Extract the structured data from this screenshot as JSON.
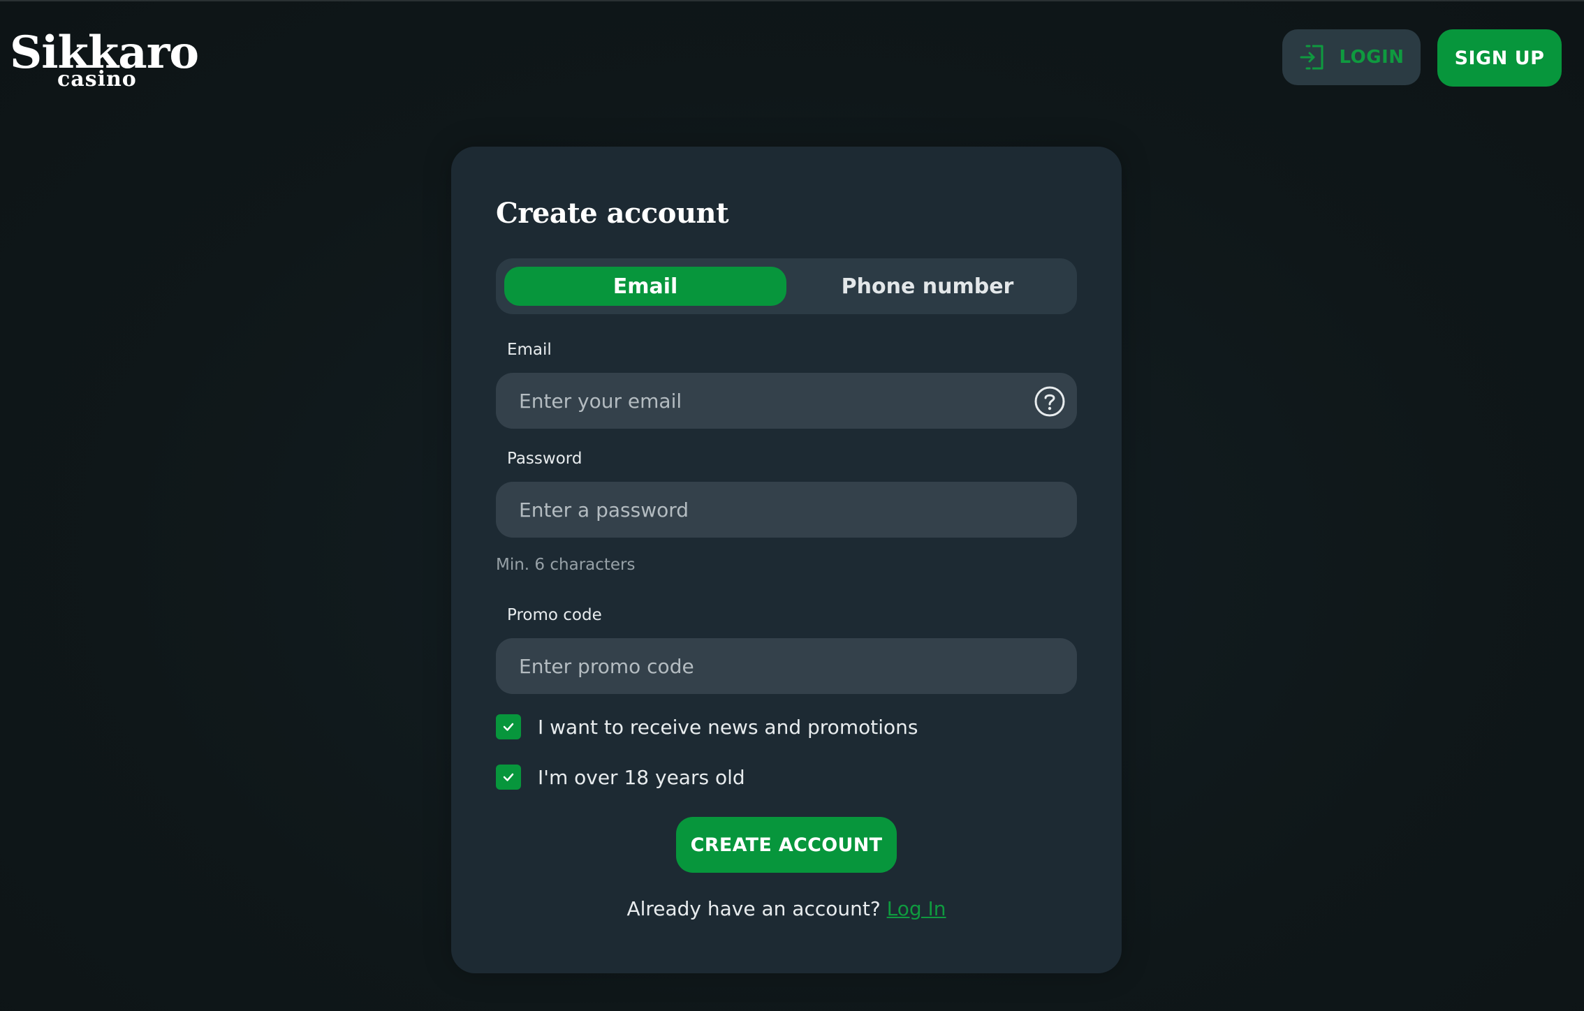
{
  "brand": {
    "name": "Sikkaro",
    "sub": "casino",
    "accent_color": "#07963c"
  },
  "header": {
    "login_label": "LOGIN",
    "login_icon": "login-door-icon",
    "signup_label": "SIGN UP"
  },
  "form": {
    "title": "Create account",
    "tabs": [
      {
        "label": "Email",
        "active": true
      },
      {
        "label": "Phone number",
        "active": false
      }
    ],
    "email": {
      "label": "Email",
      "placeholder": "Enter your email",
      "icon": "help-circle-icon"
    },
    "password": {
      "label": "Password",
      "placeholder": "Enter a password",
      "hint": "Min. 6 characters"
    },
    "promo": {
      "label": "Promo code",
      "placeholder": "Enter promo code"
    },
    "checkboxes": [
      {
        "label": "I want to receive news and promotions",
        "checked": true
      },
      {
        "label": "I'm over 18 years old",
        "checked": true
      }
    ],
    "submit_label": "CREATE ACCOUNT",
    "footer_text": "Already have an account?",
    "footer_link": "Log In"
  }
}
